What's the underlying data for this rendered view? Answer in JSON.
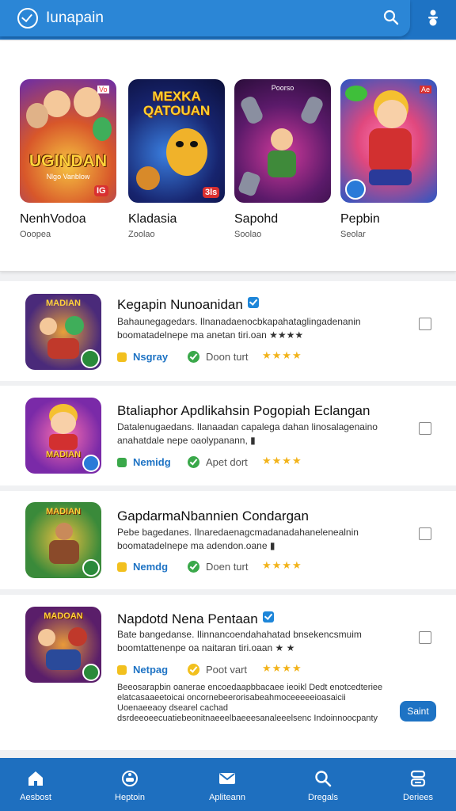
{
  "header": {
    "title": "Iunapain"
  },
  "featured": [
    {
      "name": "NenhVodoa",
      "sub": "Ooopea",
      "thumb_text_top": "",
      "thumb_text_main": "UGINDAN",
      "thumb_text_sub": "Nlgo Vanblow",
      "badge": "IG",
      "corner": "Vo"
    },
    {
      "name": "Kladasia",
      "sub": "Zoolao",
      "thumb_text_top": "MEXKA",
      "thumb_text_main": "QATOUAN",
      "thumb_text_sub": "",
      "badge": "3ls",
      "corner": ""
    },
    {
      "name": "Sapohd",
      "sub": "Soolao",
      "thumb_text_top": "Poorso",
      "thumb_text_main": "",
      "thumb_text_sub": "",
      "badge": "",
      "corner": ""
    },
    {
      "name": "Pepbin",
      "sub": "Seolar",
      "thumb_text_top": "",
      "thumb_text_main": "",
      "thumb_text_sub": "",
      "badge": "",
      "corner": "Ae"
    }
  ],
  "apps": [
    {
      "title": "Kegapin Nunoanidan",
      "verified": true,
      "desc": "Bahaunegagedars. Ilnanadaenocbkapahataglingadenanin boomatadelnepe ma anetan tiri.oan ★★★★",
      "tag": "Nsgray",
      "tag_color": "#f2c01e",
      "status": "Doon turt",
      "stars": "★★★★",
      "thumb_text": "MADIAN"
    },
    {
      "title": "Btaliaphor Apdlikahsin Pogopiah Eclangan",
      "verified": false,
      "desc": "Datalenugaedans. Ilanaadan capalega dahan linosalagenaino anahatdale nepe oaolypanann, ▮",
      "tag": "Nemidg",
      "tag_color": "#3aa84a",
      "status": "Apet dort",
      "stars": "★★★★",
      "thumb_text": "MADIAN"
    },
    {
      "title": "GapdarmaNbannien Condargan",
      "verified": false,
      "desc": "Pebe bagedanes. Ilnaredaenagcmadanadahanelenealnin boomatadelnepe ma adendon.oane ▮",
      "tag": "Nemdg",
      "tag_color": "#f2c01e",
      "status": "Doen turt",
      "stars": "★★★★",
      "thumb_text": "MADIAN"
    },
    {
      "title": "Napdotd Nena Pentaan",
      "verified": true,
      "desc": "Bate bangedanse. Ilinnancoendahahatad bnsekencsmuim boomtattenenpe oa naitaran tiri.oaan ★ ★",
      "tag": "Netpag",
      "tag_color": "#f2c01e",
      "status": "Poot vart",
      "stars": "★★★★",
      "thumb_text": "MADOAN"
    }
  ],
  "extra_desc": "Beeosarapbin oanerae encoedaapbbacaee ieoikl Dedt enotcedteriee elatcasaaeetoicai oncornebeerorisabeahmoceeeeeioasaicii Uoenaeeaoy dsearel cachad dsrdeeoeecuatiebeonitnaeeelbaeeesanaleeelsenc Indoinnoocpanty",
  "save_button": "Saint",
  "nav": [
    {
      "label": "Aesbost",
      "icon": "home-icon"
    },
    {
      "label": "Heptoin",
      "icon": "gamepad-icon"
    },
    {
      "label": "Apliteann",
      "icon": "mail-icon"
    },
    {
      "label": "Dregals",
      "icon": "search-icon"
    },
    {
      "label": "Deriees",
      "icon": "settings-icon"
    }
  ]
}
